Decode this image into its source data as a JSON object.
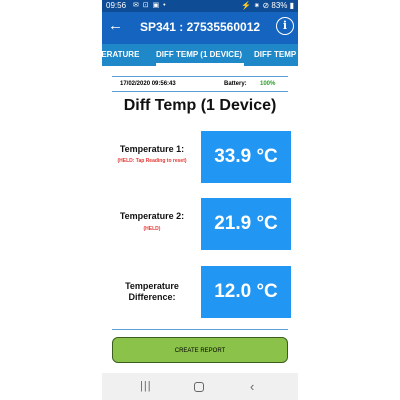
{
  "status_bar": {
    "time": "09:56",
    "notification_icons": "✉ ⊡ ▣ •",
    "right_text": "⚡ ⁕ ⊘ 83% ▮"
  },
  "app_bar": {
    "back_glyph": "←",
    "title": "SP341 : 27535560012",
    "info_glyph": "i"
  },
  "tabs": {
    "previous": "PERATURE",
    "active": "DIFF TEMP (1 DEVICE)",
    "next": "DIFF TEMP"
  },
  "info": {
    "datetime": "17/02/2020 09:56:43",
    "battery_label": "Battery:",
    "battery_value": "100%"
  },
  "main": {
    "heading": "Diff Temp (1 Device)",
    "readings": [
      {
        "label": "Temperature 1:",
        "sub": "(HELD: Tap Reading to reset)",
        "value": "33.9 °C"
      },
      {
        "label": "Temperature 2:",
        "sub": "(HELD)",
        "value": "21.9 °C"
      },
      {
        "label_line1": "Temperature",
        "label_line2": "Difference:",
        "value": "12.0 °C"
      }
    ]
  },
  "report_button": "CREATE REPORT",
  "nav": {
    "recent": "|||",
    "back": "‹"
  },
  "colors": {
    "status_bar": "#0f4c96",
    "app_bar": "#1565c0",
    "tab_bar": "#1e88c9",
    "reading_box": "#2196f3",
    "report_button": "#8bc34a",
    "held_text": "#e53935",
    "battery_value": "#2e9e2e"
  }
}
